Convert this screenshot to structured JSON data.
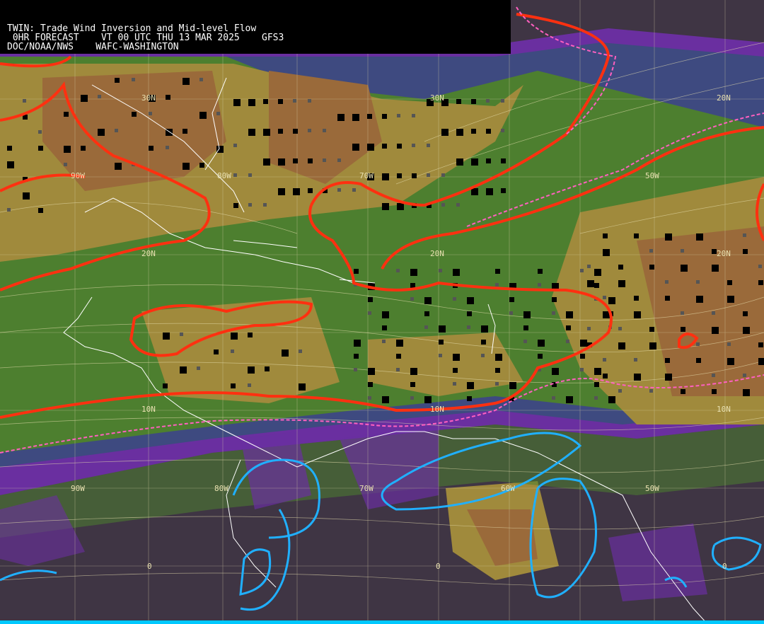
{
  "header": {
    "line1": "TWIN: Trade Wind Inversion and Mid-level Flow",
    "line2": " 0HR FORECAST    VT 00 UTC THU 13 MAR 2025    GFS3",
    "line3": "DOC/NOAA/NWS    WAFC-WASHINGTON"
  },
  "map_labels": {
    "lat_30n_a": "30N",
    "lat_30n_b": "30N",
    "lat_20n_a": "20N",
    "lat_20n_b": "20N",
    "lat_20n_c": "20N",
    "lat_20n_d": "20N",
    "lat_10n_a": "10N",
    "lat_10n_b": "10N",
    "lat_10n_c": "10N",
    "lon_90w_a": "90W",
    "lon_80w_a": "80W",
    "lon_70w_a": "70W",
    "lon_50w_a": "50W",
    "lon_90w_b": "90W",
    "lon_80w_b": "80W",
    "lon_70w_b": "70W",
    "lon_60w_b": "60W",
    "lon_50w_b": "50W",
    "eq_a": "0",
    "eq_b": "0",
    "eq_c": "0"
  },
  "colors": {
    "dark": "#3f3544",
    "purple": "#6a2fa0",
    "slate": "#3e4a80",
    "green_dark": "#3a6a2a",
    "green": "#4d7f2f",
    "olive": "#a08a3c",
    "brown": "#9a6a3a",
    "red_contour": "#ff3010",
    "pink_contour": "#ff60c0",
    "cyan_contour": "#20b0ff",
    "grid": "#d8d0a8",
    "coast": "#ffffff"
  }
}
